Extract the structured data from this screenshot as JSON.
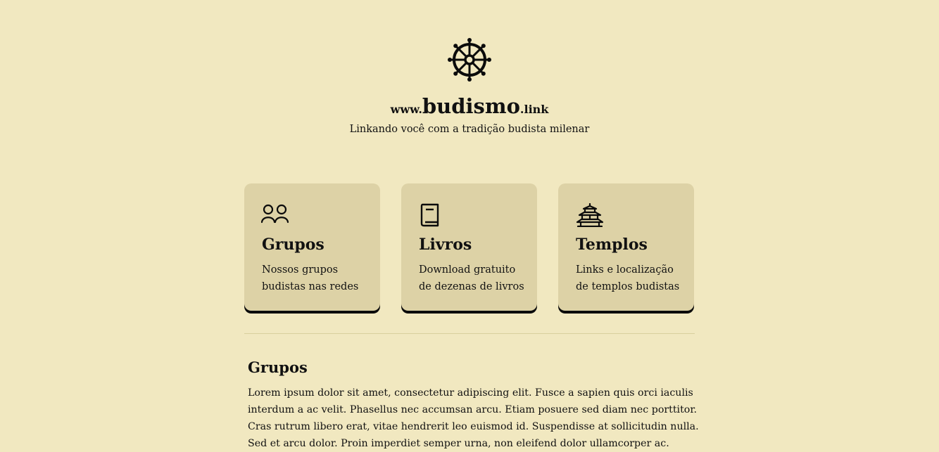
{
  "header": {
    "logo_icon": "dharma-wheel-icon",
    "title_prefix": "www.",
    "title_main": "budismo",
    "title_suffix": ".link",
    "tagline": "Linkando você com a tradição budista milenar"
  },
  "cards": [
    {
      "icon": "people-icon",
      "title": "Grupos",
      "desc_line1": "Nossos grupos",
      "desc_line2": "budistas nas redes"
    },
    {
      "icon": "book-icon",
      "title": "Livros",
      "desc_line1": "Download gratuito",
      "desc_line2": "de dezenas de livros"
    },
    {
      "icon": "temple-icon",
      "title": "Templos",
      "desc_line1": "Links e localização",
      "desc_line2": "de templos budistas"
    }
  ],
  "section": {
    "title": "Grupos",
    "lines": [
      "Lorem ipsum dolor sit amet, consectetur adipiscing elit. Fusce a sapien quis orci iaculis",
      "interdum a ac velit. Phasellus nec accumsan arcu. Etiam posuere sed diam nec porttitor.",
      "Cras rutrum libero erat, vitae hendrerit leo euismod id. Suspendisse at sollicitudin nulla.",
      "Sed et arcu dolor. Proin imperdiet semper urna, non eleifend dolor ullamcorper ac."
    ]
  },
  "colors": {
    "background": "#f1e8c0",
    "card": "#ddd2a6",
    "text": "#111111"
  }
}
